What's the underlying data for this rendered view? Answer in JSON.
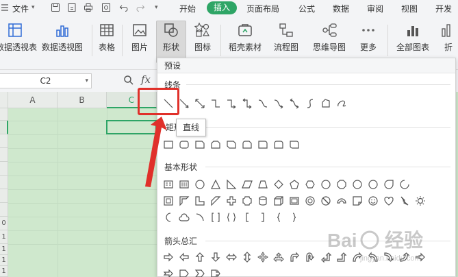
{
  "menu": {
    "file_label": "文件",
    "tabs": [
      "开始",
      "插入",
      "页面布局",
      "公式",
      "数据",
      "审阅",
      "视图",
      "开发"
    ]
  },
  "ribbon": {
    "buttons": [
      "数据透视表",
      "数据透视图",
      "表格",
      "图片",
      "形状",
      "图标",
      "稻壳素材",
      "流程图",
      "思维导图",
      "更多",
      "全部图表",
      "折"
    ]
  },
  "formula_bar": {
    "cell_ref": "C2",
    "fx": "fx"
  },
  "sheet": {
    "columns": [
      "A",
      "B",
      "C"
    ],
    "rows": [
      "0",
      "1",
      "1",
      "1",
      "1"
    ]
  },
  "shapes_panel": {
    "title": "预设",
    "sections": {
      "lines": "线条",
      "rect": "矩形",
      "basic": "基本形状",
      "arrows": "箭头总汇"
    },
    "tooltip": "直线"
  },
  "watermark": {
    "text": "Baidu经验",
    "url": "jingyan.baidu.com"
  },
  "colors": {
    "accent": "#2ea566",
    "highlight": "#e0302a",
    "sheet_bg": "#cfe8cd"
  }
}
